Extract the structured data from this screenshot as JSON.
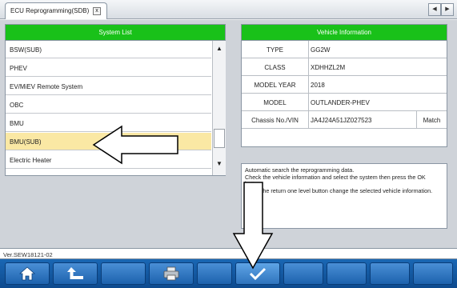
{
  "tab": {
    "title": "ECU Reprogramming(SDB)",
    "close": "x"
  },
  "nav": {
    "left": "◀",
    "right": "▶"
  },
  "system_list": {
    "header": "System List",
    "items": [
      {
        "label": "BSW(SUB)"
      },
      {
        "label": "PHEV"
      },
      {
        "label": "EV/MiEV Remote System"
      },
      {
        "label": "OBC"
      },
      {
        "label": "BMU"
      },
      {
        "label": "BMU(SUB)",
        "selected": true
      },
      {
        "label": "Electric Heater"
      }
    ]
  },
  "vehicle_info": {
    "header": "Vehicle Information",
    "rows": [
      {
        "label": "TYPE",
        "value": "GG2W"
      },
      {
        "label": "CLASS",
        "value": "XDHHZL2M"
      },
      {
        "label": "MODEL YEAR",
        "value": "2018"
      },
      {
        "label": "MODEL",
        "value": "OUTLANDER-PHEV"
      },
      {
        "label": "Chassis No./VIN",
        "value": "JA4J24A51JZ027523"
      }
    ],
    "match": "Match"
  },
  "message": {
    "lines": [
      "Automatic search the reprogramming data.",
      "Check the vehicle information and select the system then press the OK button.",
      "Press the return one level button change the selected vehicle information."
    ]
  },
  "version": "Ver.SEW18121-02",
  "toolbar": {
    "buttons": [
      "home-icon",
      "return-icon",
      "print-icon",
      "ok-check-icon"
    ]
  },
  "colors": {
    "header_green": "#19c119",
    "selected_row": "#fae8a4",
    "toolbar_blue": "#1a67b4"
  }
}
